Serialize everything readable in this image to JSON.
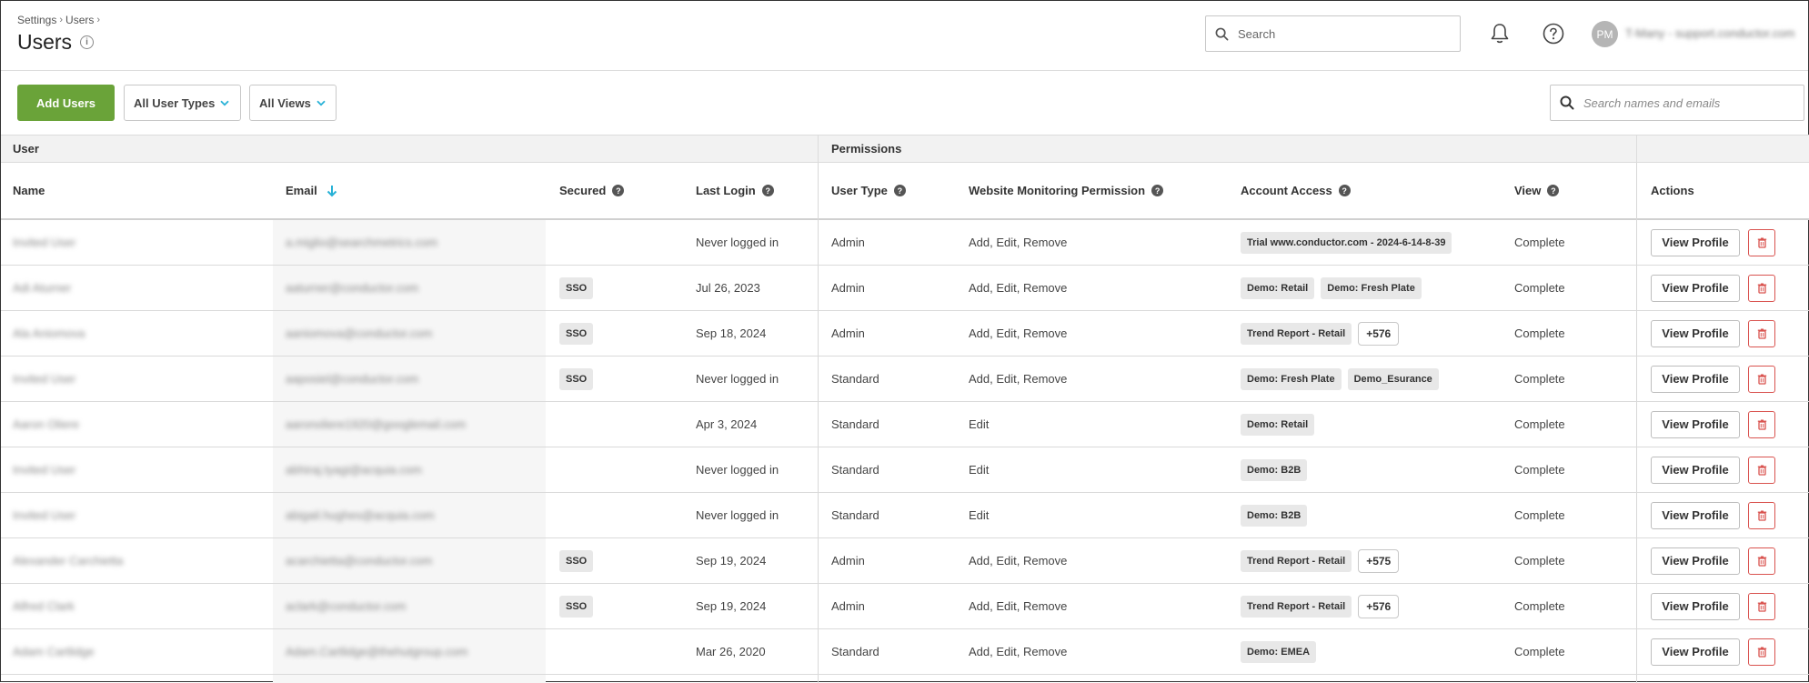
{
  "breadcrumb": {
    "items": [
      "Settings",
      "Users"
    ]
  },
  "page": {
    "title": "Users"
  },
  "global_search": {
    "placeholder": "Search"
  },
  "account": {
    "initials": "PM",
    "display_name": "T-Many - support.conductor.com"
  },
  "toolbar": {
    "add_label": "Add Users",
    "user_types_label": "All User Types",
    "views_label": "All Views",
    "search_placeholder": "Search names and emails"
  },
  "table": {
    "groups": {
      "user": "User",
      "permissions": "Permissions"
    },
    "columns": {
      "name": "Name",
      "email": "Email",
      "secured": "Secured",
      "last_login": "Last Login",
      "user_type": "User Type",
      "wmp": "Website Monitoring Permission",
      "account_access": "Account Access",
      "view": "View",
      "actions": "Actions"
    },
    "view_profile_label": "View Profile",
    "rows": [
      {
        "name": "Invited User",
        "email": "a.miglio@searchmetrics.com",
        "secured": "",
        "last_login": "Never logged in",
        "user_type": "Admin",
        "wmp": "Add, Edit, Remove",
        "access": [
          "Trial www.conductor.com - 2024-6-14-8-39"
        ],
        "extra": "",
        "view": "Complete"
      },
      {
        "name": "Adi Aturner",
        "email": "aaturner@conductor.com",
        "secured": "SSO",
        "last_login": "Jul 26, 2023",
        "user_type": "Admin",
        "wmp": "Add, Edit, Remove",
        "access": [
          "Demo: Retail",
          "Demo: Fresh Plate"
        ],
        "extra": "",
        "view": "Complete"
      },
      {
        "name": "Ala Aniomova",
        "email": "aaniomova@conductor.com",
        "secured": "SSO",
        "last_login": "Sep 18, 2024",
        "user_type": "Admin",
        "wmp": "Add, Edit, Remove",
        "access": [
          "Trend Report - Retail"
        ],
        "extra": "+576",
        "view": "Complete"
      },
      {
        "name": "Invited User",
        "email": "aaposiel@conductor.com",
        "secured": "SSO",
        "last_login": "Never logged in",
        "user_type": "Standard",
        "wmp": "Add, Edit, Remove",
        "access": [
          "Demo: Fresh Plate",
          "Demo_Esurance"
        ],
        "extra": "",
        "view": "Complete"
      },
      {
        "name": "Aaron Oliere",
        "email": "aaronoliere1920@googlemail.com",
        "secured": "",
        "last_login": "Apr 3, 2024",
        "user_type": "Standard",
        "wmp": "Edit",
        "access": [
          "Demo: Retail"
        ],
        "extra": "",
        "view": "Complete"
      },
      {
        "name": "Invited User",
        "email": "abhiraj.tyagi@acquia.com",
        "secured": "",
        "last_login": "Never logged in",
        "user_type": "Standard",
        "wmp": "Edit",
        "access": [
          "Demo: B2B"
        ],
        "extra": "",
        "view": "Complete"
      },
      {
        "name": "Invited User",
        "email": "abigail.hughes@acquia.com",
        "secured": "",
        "last_login": "Never logged in",
        "user_type": "Standard",
        "wmp": "Edit",
        "access": [
          "Demo: B2B"
        ],
        "extra": "",
        "view": "Complete"
      },
      {
        "name": "Alexander Carchietta",
        "email": "acarchietta@conductor.com",
        "secured": "SSO",
        "last_login": "Sep 19, 2024",
        "user_type": "Admin",
        "wmp": "Add, Edit, Remove",
        "access": [
          "Trend Report - Retail"
        ],
        "extra": "+575",
        "view": "Complete"
      },
      {
        "name": "Alfred Clark",
        "email": "aclark@conductor.com",
        "secured": "SSO",
        "last_login": "Sep 19, 2024",
        "user_type": "Admin",
        "wmp": "Add, Edit, Remove",
        "access": [
          "Trend Report - Retail"
        ],
        "extra": "+576",
        "view": "Complete"
      },
      {
        "name": "Adam Cartlidge",
        "email": "Adam.Cartlidge@thehutgroup.com",
        "secured": "",
        "last_login": "Mar 26, 2020",
        "user_type": "Standard",
        "wmp": "Add, Edit, Remove",
        "access": [
          "Demo: EMEA"
        ],
        "extra": "",
        "view": "Complete"
      }
    ]
  },
  "icons": {
    "search": "search-icon",
    "bell": "bell-icon",
    "help": "help-circle-icon",
    "info": "info-icon",
    "chevron": "chevron-down-icon",
    "sort": "arrow-down-icon",
    "question": "question-icon",
    "trash": "trash-icon"
  },
  "colors": {
    "primary": "#6aa339",
    "accent": "#27b1d6",
    "danger": "#d9534f"
  }
}
